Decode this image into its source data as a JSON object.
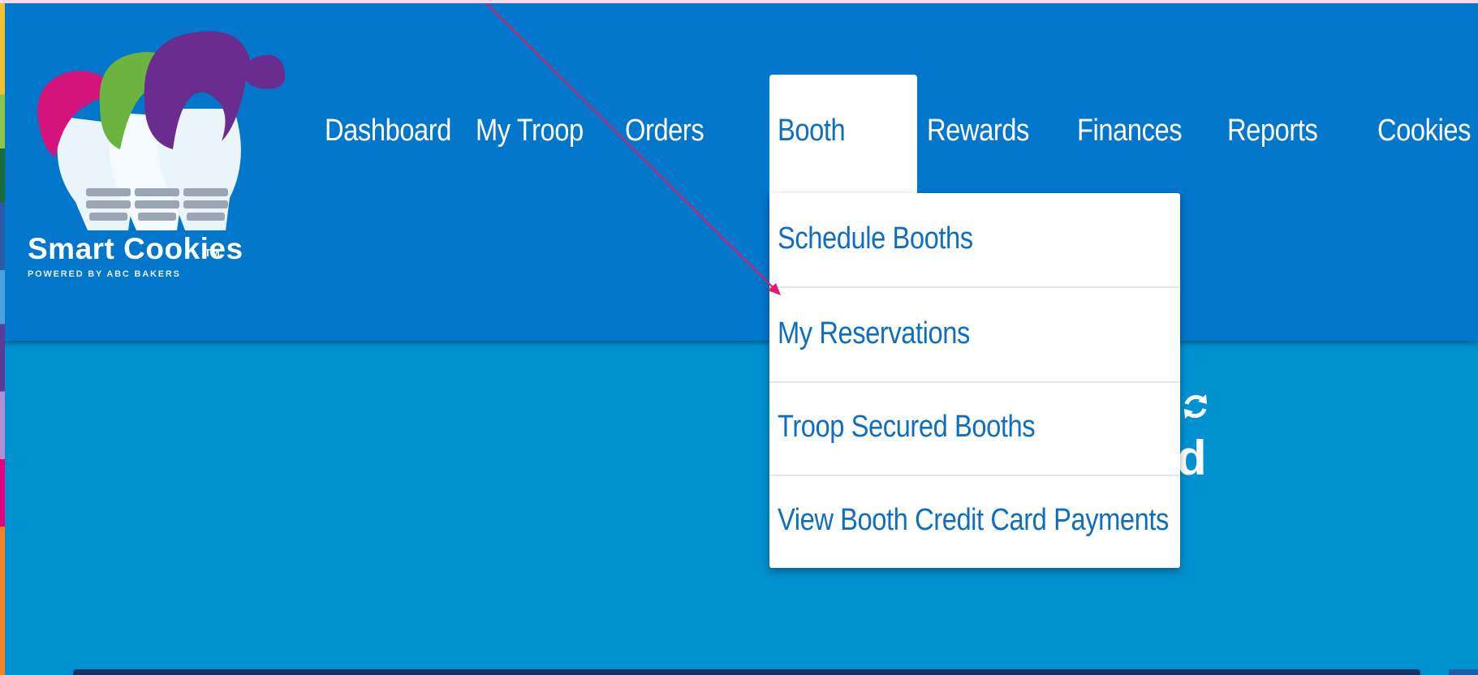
{
  "brand": {
    "title": "Smart Cookies",
    "tm": "TM",
    "subtitle": "POWERED BY ABC BAKERS"
  },
  "nav": {
    "items": [
      "Dashboard",
      "My Troop",
      "Orders",
      "Booth",
      "Rewards",
      "Finances",
      "Reports",
      "Cookies"
    ],
    "active": "Booth"
  },
  "booth_menu": {
    "items": [
      "Schedule Booths",
      "My Reservations",
      "Troop Secured Booths",
      "View Booth Credit Card Payments"
    ]
  },
  "partial_text": "d",
  "colors": {
    "header": "#0276cb",
    "page": "#0091d0",
    "link": "#0f6ebf",
    "annotation_arrow": "#e3186f"
  },
  "icons": {
    "refresh": "refresh-icon"
  }
}
